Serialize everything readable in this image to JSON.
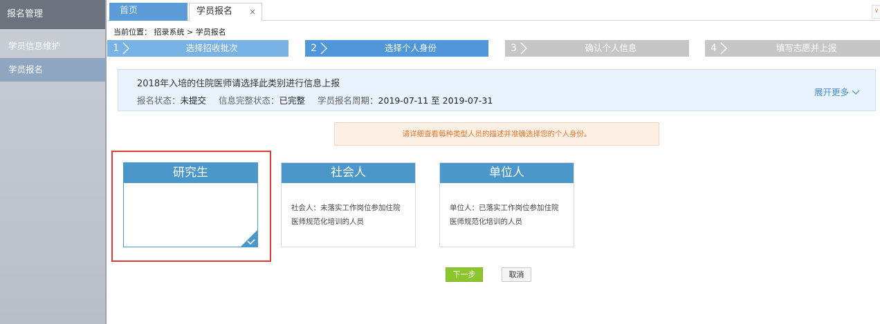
{
  "sidebar": {
    "header": "报名管理",
    "items": [
      {
        "label": "学员信息维护"
      },
      {
        "label": "学员报名"
      }
    ]
  },
  "tabs": {
    "home": "首页",
    "current": "学员报名",
    "close_symbol": "×",
    "arrow_symbol": "∨"
  },
  "breadcrumb": "当前位置： 招录系统 > 学员报名",
  "steps": [
    {
      "num": "1",
      "label": "选择招收批次"
    },
    {
      "num": "2",
      "label": "选择个人身份"
    },
    {
      "num": "3",
      "label": "确认个人信息"
    },
    {
      "num": "4",
      "label": "填写志愿并上报"
    }
  ],
  "info": {
    "title": "2018年入培的住院医师请选择此类别进行信息上报",
    "status_label": "报名状态：",
    "status_value": "未提交",
    "complete_label": "信息完整状态：",
    "complete_value": "已完整",
    "period_label": "学员报名周期：",
    "period_value": "2019-07-11 至 2019-07-31",
    "expand": "展开更多"
  },
  "notice": "请详细查看每种类型人员的描述并准确选择您的个人身份。",
  "cards": [
    {
      "title": "研究生",
      "line1": "",
      "line2": "",
      "selected": true
    },
    {
      "title": "社会人",
      "line1": "社会人：未落实工作岗位参加住院",
      "line2": "医师规范化培训的人员"
    },
    {
      "title": "单位人",
      "line1": "单位人：已落实工作岗位参加住院",
      "line2": "医师规范化培训的人员"
    }
  ],
  "buttons": {
    "next": "下一步",
    "cancel": "取消"
  },
  "colors": {
    "step_active": "#4f97d8",
    "step_done": "#79b2e4",
    "step_todo": "#c6c6c6",
    "card_head": "#4b97c9",
    "highlight": "#dd3b35",
    "next_button": "#8dc52d"
  }
}
